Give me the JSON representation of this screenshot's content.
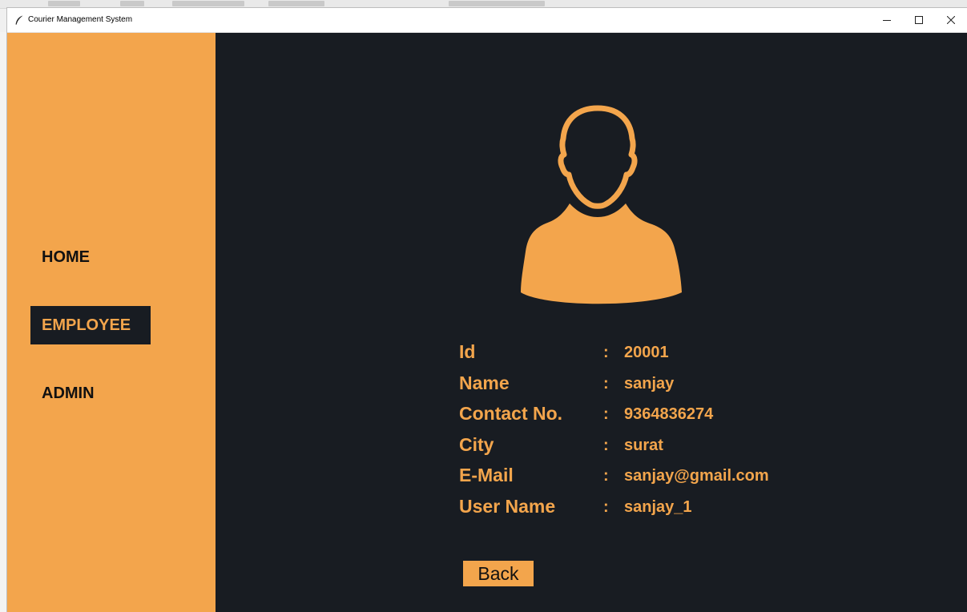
{
  "window": {
    "title": "Courier Management System"
  },
  "sidebar": {
    "items": [
      {
        "label": "HOME",
        "active": false
      },
      {
        "label": "EMPLOYEE",
        "active": true
      },
      {
        "label": "ADMIN",
        "active": false
      }
    ]
  },
  "profile": {
    "icon": "user-silhouette-icon",
    "fields": [
      {
        "label": "Id",
        "colon": ":",
        "value": "20001"
      },
      {
        "label": "Name",
        "colon": ":",
        "value": "sanjay"
      },
      {
        "label": "Contact No.",
        "colon": ":",
        "value": "9364836274"
      },
      {
        "label": "City",
        "colon": ":",
        "value": "surat"
      },
      {
        "label": "E-Mail",
        "colon": ":",
        "value": "sanjay@gmail.com"
      },
      {
        "label": "User Name",
        "colon": ":",
        "value": "sanjay_1"
      }
    ]
  },
  "actions": {
    "back_label": "Back"
  },
  "colors": {
    "accent": "#f3a54c",
    "dark": "#181c22"
  }
}
